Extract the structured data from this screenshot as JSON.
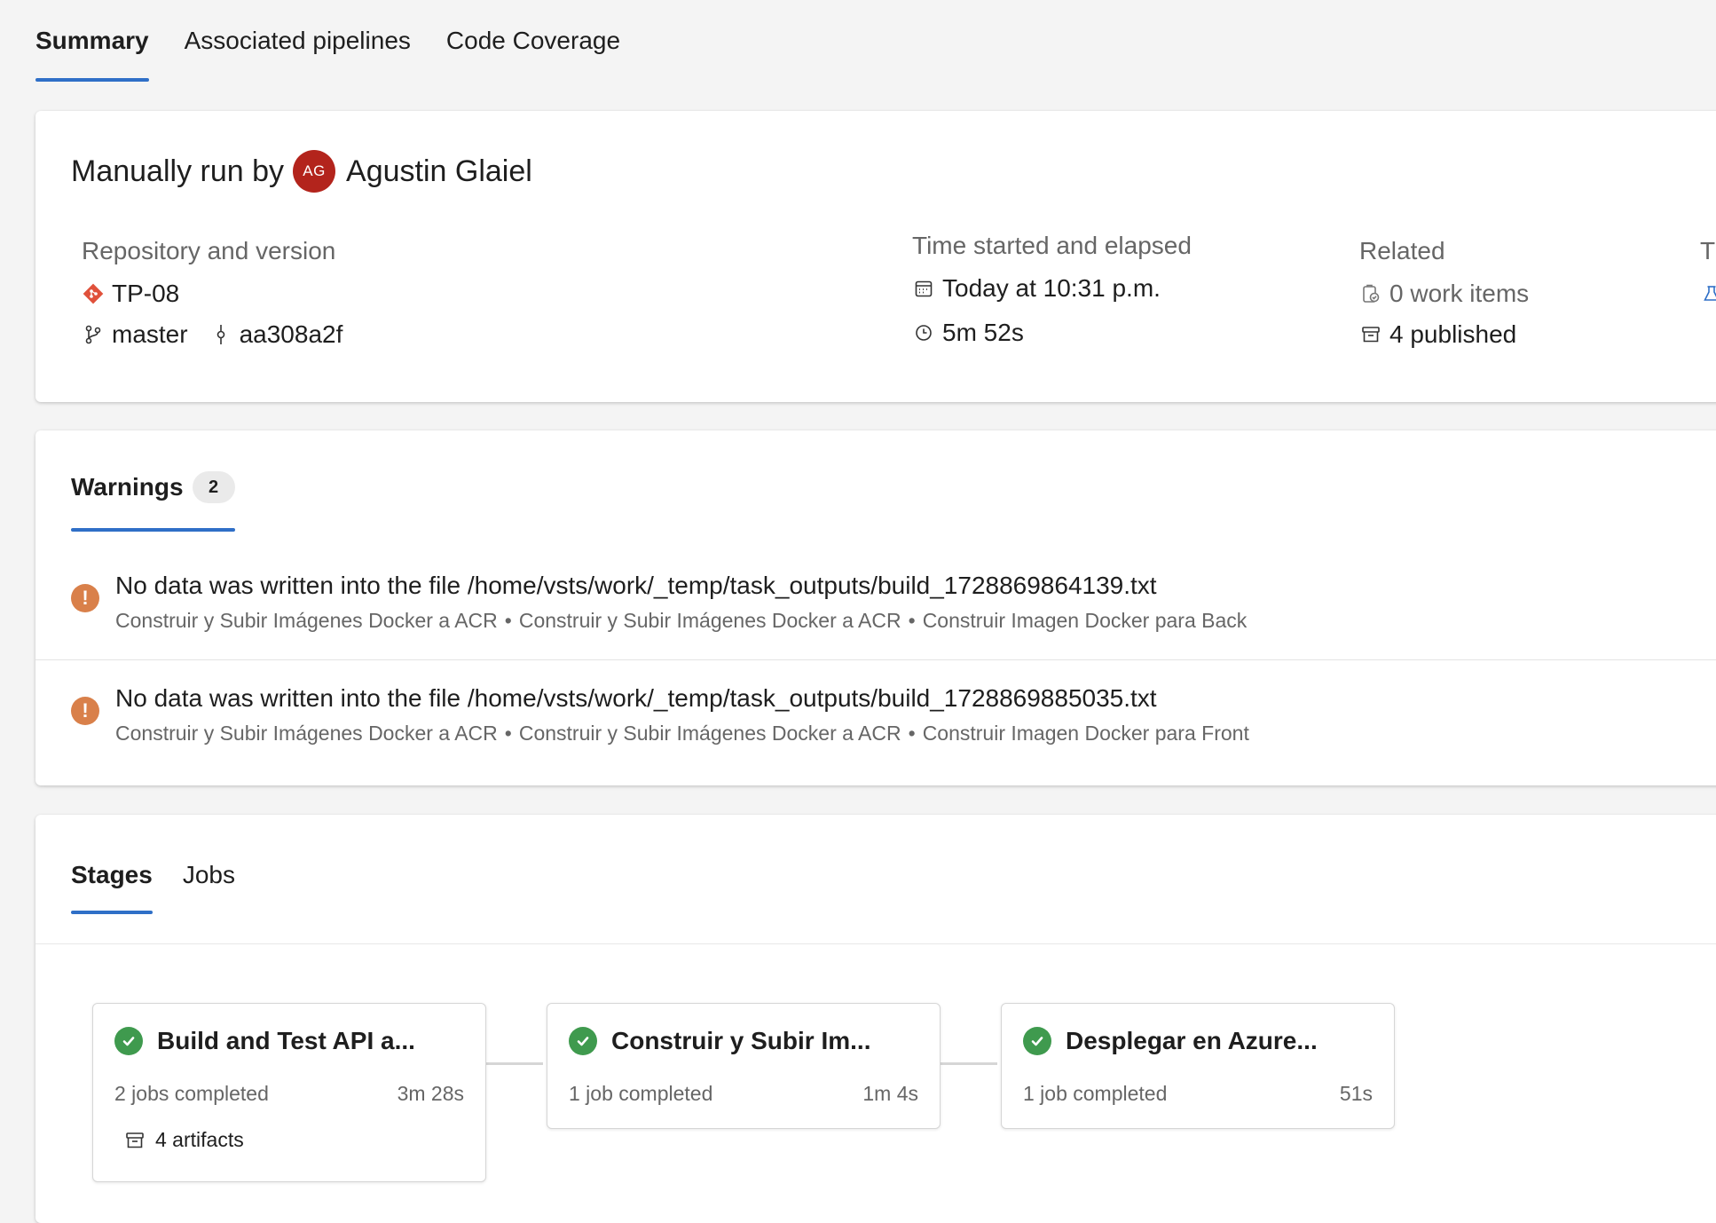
{
  "tabs": [
    "Summary",
    "Associated pipelines",
    "Code Coverage"
  ],
  "run": {
    "prefix": "Manually run by",
    "avatar_initials": "AG",
    "user": "Agustin Glaiel"
  },
  "repository": {
    "label": "Repository and version",
    "repo": "TP-08",
    "branch": "master",
    "commit": "aa308a2f"
  },
  "time": {
    "label": "Time started and elapsed",
    "started": "Today at 10:31 p.m.",
    "elapsed": "5m 52s"
  },
  "related": {
    "label": "Related",
    "work_items": "0 work items",
    "published": "4 published"
  },
  "tests_partial": {
    "label": "T"
  },
  "warnings": {
    "tab_label": "Warnings",
    "count": "2",
    "items": [
      {
        "message": "No data was written into the file /home/vsts/work/_temp/task_outputs/build_1728869864139.txt",
        "path": [
          "Construir y Subir Imágenes Docker a ACR",
          "Construir y Subir Imágenes Docker a ACR",
          "Construir Imagen Docker para Back"
        ]
      },
      {
        "message": "No data was written into the file /home/vsts/work/_temp/task_outputs/build_1728869885035.txt",
        "path": [
          "Construir y Subir Imágenes Docker a ACR",
          "Construir y Subir Imágenes Docker a ACR",
          "Construir Imagen Docker para Front"
        ]
      }
    ]
  },
  "stages_section": {
    "tabs": [
      "Stages",
      "Jobs"
    ],
    "stages": [
      {
        "title": "Build and Test API a...",
        "jobs": "2 jobs completed",
        "duration": "3m 28s",
        "artifacts": "4 artifacts"
      },
      {
        "title": "Construir y Subir Im...",
        "jobs": "1 job completed",
        "duration": "1m 4s"
      },
      {
        "title": "Desplegar en Azure...",
        "jobs": "1 job completed",
        "duration": "51s"
      }
    ]
  },
  "colors": {
    "accent": "#2f6fc7",
    "avatar": "#b3241c",
    "warning": "#d9804a",
    "success": "#3f9a4e",
    "git": "#e0513b"
  }
}
